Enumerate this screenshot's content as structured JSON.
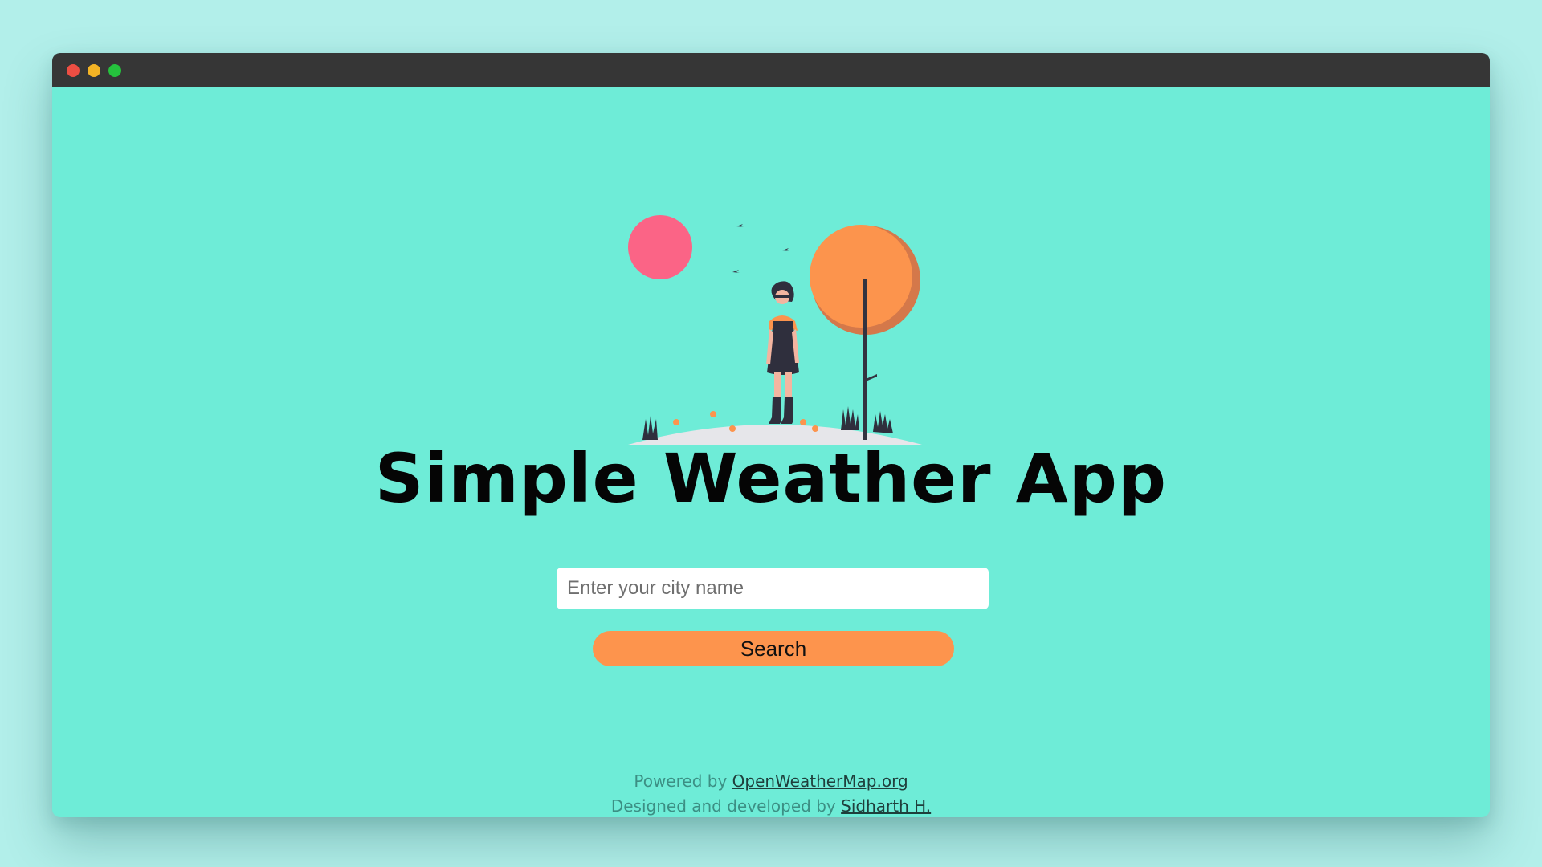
{
  "window": {
    "controls": [
      "close",
      "minimize",
      "maximize"
    ]
  },
  "illustration": {
    "icon": "woman-standing-on-hill-with-tree-and-sun-illustration"
  },
  "app": {
    "title": "Simple Weather App"
  },
  "search": {
    "placeholder": "Enter your city name",
    "value": "",
    "button_label": "Search"
  },
  "footer": {
    "powered_prefix": "Powered by",
    "powered_link": "OpenWeatherMap.org",
    "designed_prefix": "Designed and developed by",
    "designed_link": "Sidharth H."
  },
  "colors": {
    "page_background": "#b2efea",
    "app_background": "#6eecd7",
    "titlebar": "#363636",
    "accent_orange": "#fd944d",
    "sun_pink": "#fb6486"
  }
}
